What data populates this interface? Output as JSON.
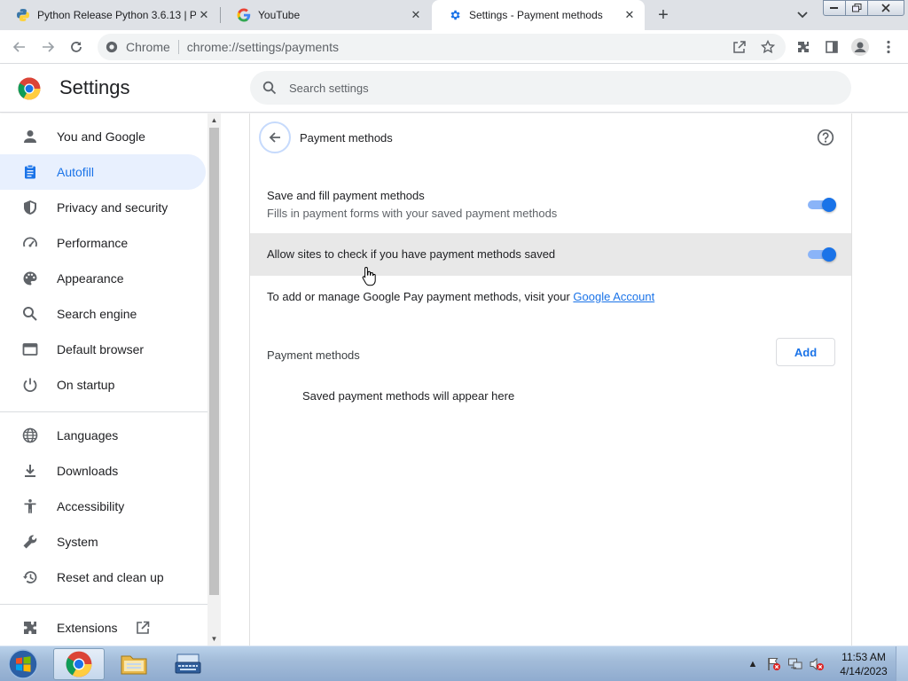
{
  "tabs": [
    {
      "title": "Python Release Python 3.6.13 | P",
      "favicon": "python-icon",
      "active": false
    },
    {
      "title": "YouTube",
      "favicon": "google-icon",
      "active": false
    },
    {
      "title": "Settings - Payment methods",
      "favicon": "gear-icon",
      "active": true
    }
  ],
  "toolbar": {
    "chip_label": "Chrome",
    "url": "chrome://settings/payments"
  },
  "settings": {
    "title": "Settings",
    "search_placeholder": "Search settings"
  },
  "sidebar": {
    "items": [
      {
        "label": "You and Google",
        "icon": "person-icon",
        "active": false
      },
      {
        "label": "Autofill",
        "icon": "clipboard-icon",
        "active": true
      },
      {
        "label": "Privacy and security",
        "icon": "shield-icon",
        "active": false
      },
      {
        "label": "Performance",
        "icon": "speedometer-icon",
        "active": false
      },
      {
        "label": "Appearance",
        "icon": "palette-icon",
        "active": false
      },
      {
        "label": "Search engine",
        "icon": "search-icon",
        "active": false
      },
      {
        "label": "Default browser",
        "icon": "browser-window-icon",
        "active": false
      },
      {
        "label": "On startup",
        "icon": "power-icon",
        "active": false
      },
      {
        "label": "Languages",
        "icon": "globe-icon",
        "active": false
      },
      {
        "label": "Downloads",
        "icon": "download-icon",
        "active": false
      },
      {
        "label": "Accessibility",
        "icon": "accessibility-icon",
        "active": false
      },
      {
        "label": "System",
        "icon": "wrench-icon",
        "active": false
      },
      {
        "label": "Reset and clean up",
        "icon": "restore-icon",
        "active": false
      },
      {
        "label": "Extensions",
        "icon": "puzzle-icon",
        "active": false
      }
    ]
  },
  "main": {
    "title": "Payment methods",
    "save_fill": {
      "label": "Save and fill payment methods",
      "sublabel": "Fills in payment forms with your saved payment methods",
      "enabled": true
    },
    "allow_sites": {
      "label": "Allow sites to check if you have payment methods saved",
      "enabled": true
    },
    "info_text": "To add or manage Google Pay payment methods, visit your ",
    "info_link": "Google Account",
    "payment_methods_heading": "Payment methods",
    "add_label": "Add",
    "empty_text": "Saved payment methods will appear here"
  },
  "taskbar": {
    "clock_time": "11:53 AM",
    "clock_date": "4/14/2023"
  },
  "colors": {
    "accent": "#1a73e8",
    "active_nav_bg": "#e8f0fe",
    "toggle_track": "#8ab4f8"
  }
}
